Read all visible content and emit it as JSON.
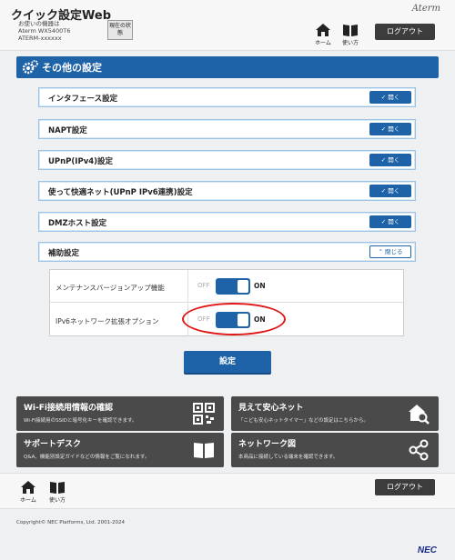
{
  "header": {
    "app_title": "クイック設定Web",
    "device_lines": [
      "お使いの機器は",
      "Aterm WX5400T6",
      "ATERM-xxxxxx"
    ],
    "status_button": "現在の状態",
    "brand": "Aterm",
    "home_label": "ホーム",
    "guide_label": "使い方",
    "logout_label": "ログアウト"
  },
  "page": {
    "title": "その他の設定"
  },
  "sections": [
    {
      "label": "インタフェース設定",
      "toggle": "開く"
    },
    {
      "label": "NAPT設定",
      "toggle": "開く"
    },
    {
      "label": "UPnP(IPv4)設定",
      "toggle": "開く"
    },
    {
      "label": "使って快適ネット(UPnP IPv6連携)設定",
      "toggle": "開く"
    },
    {
      "label": "DMZホスト設定",
      "toggle": "開く"
    },
    {
      "label": "補助設定",
      "toggle": "閉じる"
    }
  ],
  "aux_settings": [
    {
      "label": "メンテナンスバージョンアップ機能",
      "off": "OFF",
      "on": "ON"
    },
    {
      "label": "IPv6ネットワーク拡張オプション",
      "off": "OFF",
      "on": "ON"
    }
  ],
  "apply_button": "設定",
  "tiles": [
    {
      "title": "Wi-Fi接続用情報の確認",
      "desc": "Wi-Fi接続用のSSIDと暗号化キーを確認できます。",
      "icon": "qr-code-icon"
    },
    {
      "title": "見えて安心ネット",
      "desc": "「こども安心ネットタイマー」などの設定はこちらから。",
      "icon": "house-search-icon"
    },
    {
      "title": "サポートデスク",
      "desc": "Q&A、機能別設定ガイドなどの情報をご覧になれます。",
      "icon": "book-icon"
    },
    {
      "title": "ネットワーク図",
      "desc": "本商品に接続している端末を確認できます。",
      "icon": "network-icon"
    }
  ],
  "footer": {
    "home_label": "ホーム",
    "guide_label": "使い方",
    "logout_label": "ログアウト",
    "copyright": "Copyright© NEC Platforms, Ltd. 2001-2024",
    "logo": "NEC"
  },
  "colors": {
    "primary": "#1e63a8",
    "tile": "#4a4a4a",
    "highlight": "#e01818"
  }
}
